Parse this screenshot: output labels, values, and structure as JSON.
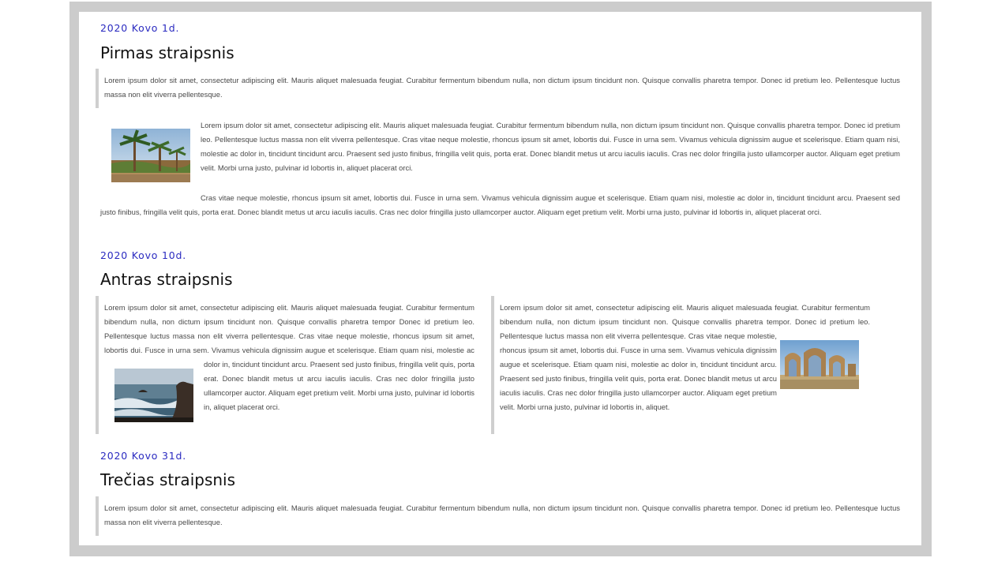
{
  "articles": [
    {
      "date": "2020 Kovo 1d.",
      "title": "Pirmas straipsnis",
      "quote": "Lorem ipsum dolor sit amet, consectetur adipiscing elit. Mauris aliquet malesuada feugiat. Curabitur fermentum bibendum nulla, non dictum ipsum tincidunt non. Quisque convallis pharetra tempor. Donec id pretium leo. Pellentesque luctus massa non elit viverra pellentesque.",
      "image": "palm-trees-promenade-photo",
      "para1": "Lorem ipsum dolor sit amet, consectetur adipiscing elit. Mauris aliquet malesuada feugiat. Curabitur fermentum bibendum nulla, non dictum ipsum tincidunt non. Quisque convallis pharetra tempor. Donec id pretium leo. Pellentesque luctus massa non elit viverra pellentesque. Cras vitae neque molestie, rhoncus ipsum sit amet, lobortis dui. Fusce in urna sem. Vivamus vehicula dignissim augue et scelerisque. Etiam quam nisi, molestie ac dolor in, tincidunt tincidunt arcu. Praesent sed justo finibus, fringilla velit quis, porta erat. Donec blandit metus ut arcu iaculis iaculis. Cras nec dolor fringilla justo ullamcorper auctor. Aliquam eget pretium velit. Morbi urna justo, pulvinar id lobortis in, aliquet placerat orci.",
      "para2": "Cras vitae neque molestie, rhoncus ipsum sit amet, lobortis dui. Fusce in urna sem. Vivamus vehicula dignissim augue et scelerisque. Etiam quam nisi, molestie ac dolor in, tincidunt tincidunt arcu. Praesent sed justo finibus, fringilla velit quis, porta erat. Donec blandit metus ut arcu iaculis iaculis. Cras nec dolor fringilla justo ullamcorper auctor. Aliquam eget pretium velit. Morbi urna justo, pulvinar id lobortis in, aliquet placerat orci."
    },
    {
      "date": "2020 Kovo 10d.",
      "title": "Antras straipsnis",
      "col_left": "Lorem ipsum dolor sit amet, consectetur adipiscing elit. Mauris aliquet malesuada feugiat. Curabitur fermentum bibendum nulla, non dictum ipsum tincidunt non. Quisque convallis pharetra tempor Donec id pretium leo. Pellentesque luctus massa non elit viverra pellentesque. Cras vitae neque molestie, rhoncus ipsum sit amet, lobortis dui. Fusce in urna sem. Vivamus vehicula dignissim augue et scelerisque. Etiam quam nisi, molestie ac dolor in, tincidunt tincidunt arcu. Praesent sed justo finibus, fringilla velit quis, porta erat. Donec blandit metus ut arcu iaculis iaculis. Cras nec dolor fringilla justo ullamcorper auctor. Aliquam eget pretium velit. Morbi urna justo, pulvinar id lobortis in, aliquet placerat orci.",
      "col_left_image": "sea-waves-rocks-photo",
      "col_right": "Lorem ipsum dolor sit amet, consectetur adipiscing elit. Mauris aliquet malesuada feugiat. Curabitur fermentum bibendum nulla, non dictum ipsum tincidunt non. Quisque convallis pharetra tempor. Donec id pretium leo. Pellentesque luctus massa non elit viverra pellentesque. Cras vitae neque molestie, rhoncus ipsum sit amet, lobortis dui. Fusce in urna sem. Vivamus vehicula dignissim augue et scelerisque. Etiam quam nisi, molestie ac dolor in, tincidunt tincidunt arcu. Praesent sed justo finibus, fringilla velit quis, porta erat. Donec blandit metus ut arcu iaculis iaculis. Cras nec dolor fringilla justo ullamcorper auctor. Aliquam eget pretium velit. Morbi urna justo, pulvinar id lobortis in, aliquet.",
      "col_right_image": "stone-ruins-arches-photo"
    },
    {
      "date": "2020 Kovo 31d.",
      "title": "Trečias straipsnis",
      "quote": "Lorem ipsum dolor sit amet, consectetur adipiscing elit. Mauris aliquet malesuada feugiat. Curabitur fermentum bibendum nulla, non dictum ipsum tincidunt non. Quisque convallis pharetra tempor. Donec id pretium leo. Pellentesque luctus massa non elit viverra pellentesque."
    }
  ],
  "colors": {
    "date": "#2a2ac0",
    "frame": "#cccccc",
    "quote_border": "#cfcfcf"
  }
}
